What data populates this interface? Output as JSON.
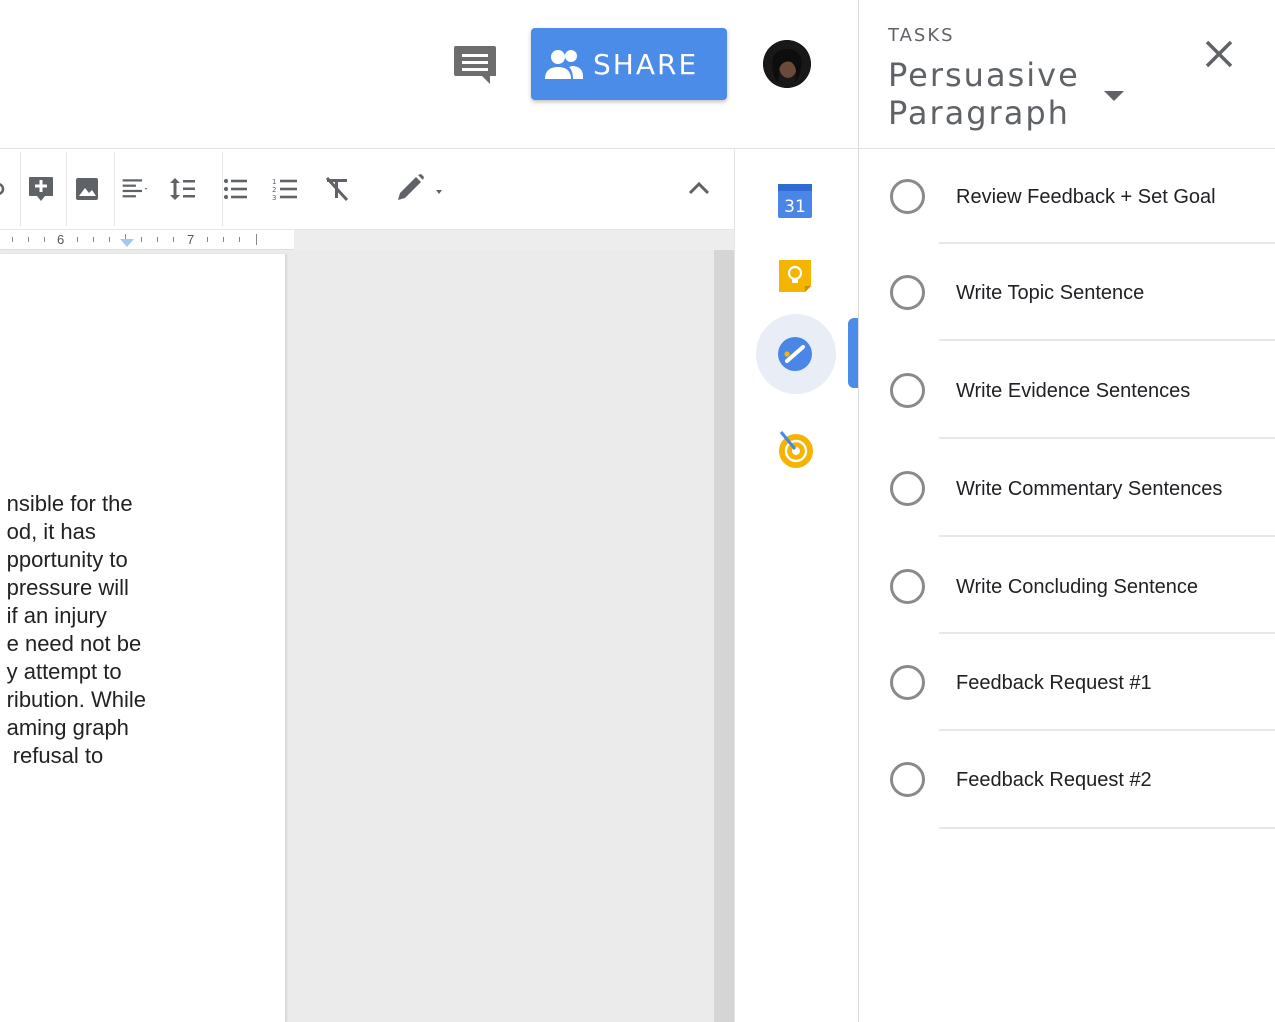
{
  "header": {
    "share_label": "SHARE"
  },
  "toolbar": {
    "icons": [
      "insert-comment-icon",
      "insert-image-icon",
      "align-left-icon",
      "line-spacing-icon",
      "bulleted-list-icon",
      "numbered-list-icon",
      "clear-formatting-icon",
      "editing-mode-icon",
      "collapse-toolbar-icon"
    ]
  },
  "ruler": {
    "numbers": [
      "6",
      "7"
    ]
  },
  "document": {
    "lines": [
      "nsible for the",
      "od, it has",
      "pportunity to",
      "pressure will",
      "if an injury",
      "e need not be",
      "y attempt to",
      "ribution. While",
      "aming graph",
      " refusal to"
    ]
  },
  "side_apps": {
    "calendar_day": "31",
    "apps": [
      "calendar-icon",
      "keep-icon",
      "tasks-icon",
      "goals-icon"
    ],
    "active": "tasks-icon"
  },
  "tasks_panel": {
    "section_label": "TASKS",
    "list_title": "Persuasive Paragraph",
    "items": [
      {
        "label": "Review Feedback + Set Goal",
        "done": false
      },
      {
        "label": "Write Topic Sentence",
        "done": false
      },
      {
        "label": "Write Evidence Sentences",
        "done": false
      },
      {
        "label": "Write Commentary Sentences",
        "done": false
      },
      {
        "label": "Write Concluding Sentence",
        "done": false
      },
      {
        "label": "Feedback Request #1",
        "done": false
      },
      {
        "label": "Feedback Request #2",
        "done": false
      }
    ]
  },
  "colors": {
    "accent": "#4a8ce8",
    "icon_gray": "#5f6368",
    "keep_yellow": "#f4b400"
  }
}
